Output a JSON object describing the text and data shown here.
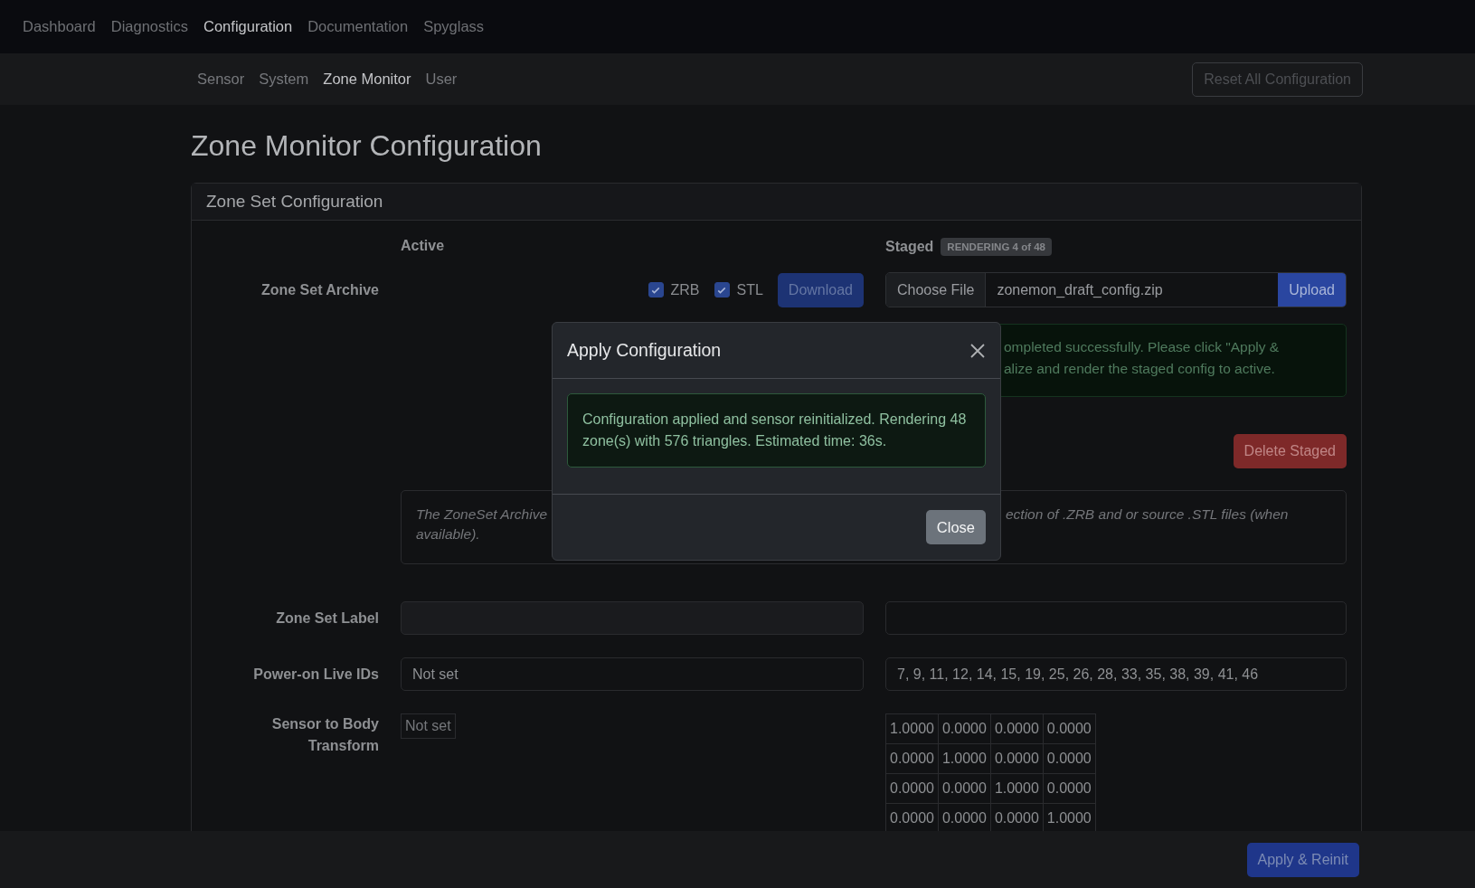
{
  "top_nav": [
    {
      "label": "Dashboard",
      "selected": false
    },
    {
      "label": "Diagnostics",
      "selected": false
    },
    {
      "label": "Configuration",
      "selected": true
    },
    {
      "label": "Documentation",
      "selected": false
    },
    {
      "label": "Spyglass",
      "selected": false
    }
  ],
  "sub_nav": [
    {
      "label": "Sensor",
      "selected": false
    },
    {
      "label": "System",
      "selected": false
    },
    {
      "label": "Zone Monitor",
      "selected": true
    },
    {
      "label": "User",
      "selected": false
    }
  ],
  "reset_button": "Reset All Configuration",
  "page_title": "Zone Monitor Configuration",
  "card": {
    "title": "Zone Set Configuration",
    "active_heading": "Active",
    "staged_heading": "Staged",
    "staged_badge": "RENDERING 4 of 48",
    "archive": {
      "label": "Zone Set Archive",
      "options": [
        {
          "label": "ZRB",
          "checked": true
        },
        {
          "label": "STL",
          "checked": true
        }
      ],
      "download_button": "Download",
      "choose_file_button": "Choose File",
      "file_name": "zonemon_draft_config.zip",
      "upload_button": "Upload",
      "staged_alert_lines": [
        "ompleted successfully. Please click \"Apply &",
        "alize and render the staged config to active."
      ],
      "delete_button": "Delete Staged",
      "description_left_lines": [
        "The ZoneSet Archive",
        "available)."
      ],
      "description_right": "ection of .ZRB and or source .STL files (when"
    },
    "fields": [
      {
        "label": "Zone Set Label"
      },
      {
        "label": "Power-on Live IDs",
        "active": "Not set",
        "staged": "7, 9, 11, 12, 14, 15, 19, 25, 26, 28, 33, 35, 38, 39, 41, 46"
      }
    ],
    "transform": {
      "label": "Sensor to Body Transform",
      "active": "Not set",
      "staged_matrix": [
        [
          "1.0000",
          "0.0000",
          "0.0000",
          "0.0000"
        ],
        [
          "0.0000",
          "1.0000",
          "0.0000",
          "0.0000"
        ],
        [
          "0.0000",
          "0.0000",
          "1.0000",
          "0.0000"
        ],
        [
          "0.0000",
          "0.0000",
          "0.0000",
          "1.0000"
        ]
      ]
    }
  },
  "footer_button": "Apply & Reinit",
  "modal": {
    "title": "Apply Configuration",
    "message": "Configuration applied and sensor reinitialized. Rendering 48 zone(s) with 576 triangles. Estimated time: 36s.",
    "close_button": "Close"
  }
}
